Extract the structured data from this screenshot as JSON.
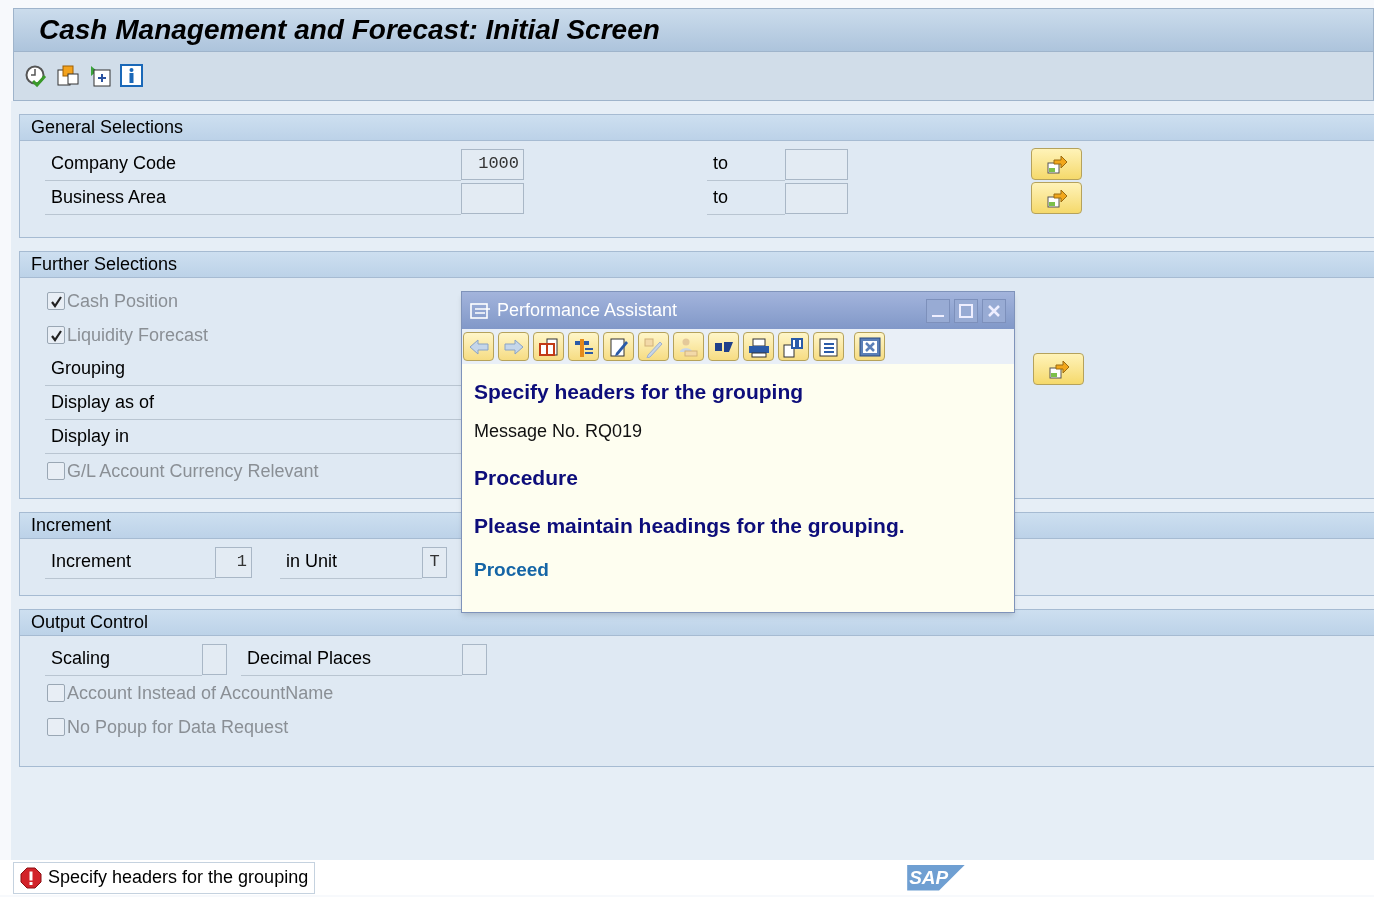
{
  "window": {
    "title": "Cash Management and Forecast: Initial Screen"
  },
  "sections": [
    {
      "title": "General Selections",
      "rows": [
        {
          "kind": "range",
          "label": "Company Code",
          "value": "1000",
          "to_label": "to"
        },
        {
          "kind": "range",
          "label": "Business Area",
          "to_label": "to"
        }
      ]
    },
    {
      "title": "Further Selections",
      "rows": [
        {
          "kind": "checkbox",
          "label": "Cash Position",
          "checked": true,
          "disabled": true
        },
        {
          "kind": "checkbox",
          "label": "Liquidity Forecast",
          "checked": true,
          "disabled": true
        },
        {
          "kind": "field",
          "label": "Grouping",
          "multiple_selection": true
        },
        {
          "kind": "field",
          "label": "Display as of",
          "multiple_selection": false
        },
        {
          "kind": "field",
          "label": "Display in",
          "multiple_selection": false
        },
        {
          "kind": "checkbox",
          "label": "G/L Account Currency Relevant",
          "checked": false,
          "disabled": true
        }
      ]
    },
    {
      "title": "Increment",
      "rows": [
        {
          "kind": "pair",
          "fields": [
            {
              "label": "Increment",
              "value": "1"
            },
            {
              "label": "in Unit",
              "value": "T"
            }
          ]
        }
      ]
    },
    {
      "title": "Output Control",
      "rows": [
        {
          "kind": "pair",
          "fields": [
            {
              "label": "Scaling"
            },
            {
              "label": "Decimal Places"
            }
          ]
        },
        {
          "kind": "checkbox",
          "label": "Account Instead of AccountName",
          "checked": false,
          "disabled": true
        },
        {
          "kind": "checkbox",
          "label": "No Popup for Data Request",
          "checked": false,
          "disabled": true
        }
      ]
    }
  ],
  "popup": {
    "title": "Performance Assistant",
    "heading": "Specify headers for the grouping",
    "message_no": "Message No. RQ019",
    "procedure_heading": "Procedure",
    "procedure_text": "Please maintain headings for the grouping.",
    "link": "Proceed"
  },
  "status_bar": {
    "message": "Specify headers for the grouping",
    "logo": "SAP"
  }
}
